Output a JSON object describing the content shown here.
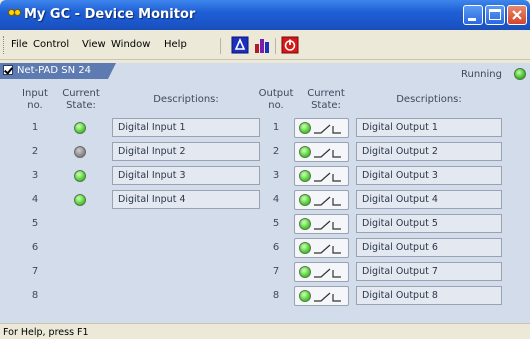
{
  "window": {
    "title": "My GC - Device Monitor"
  },
  "menu": [
    "File",
    "Control",
    "View",
    "Window",
    "Help"
  ],
  "toolbar": {
    "icons": [
      "monitor-icon",
      "bar-chart-icon",
      "power-icon"
    ]
  },
  "device": {
    "tab_label": "Net-PAD SN 24",
    "checked": true,
    "status": "Running",
    "status_color": "#48c630"
  },
  "inputs": {
    "header_no": "Input\nno.",
    "header_state": "Current\nState:",
    "header_desc": "Descriptions:",
    "rows": [
      {
        "no": "1",
        "state": "on",
        "desc": "Digital Input 1"
      },
      {
        "no": "2",
        "state": "off",
        "desc": "Digital Input 2"
      },
      {
        "no": "3",
        "state": "on",
        "desc": "Digital Input 3"
      },
      {
        "no": "4",
        "state": "on",
        "desc": "Digital Input 4"
      },
      {
        "no": "5"
      },
      {
        "no": "6"
      },
      {
        "no": "7"
      },
      {
        "no": "8"
      }
    ]
  },
  "outputs": {
    "header_no": "Output\nno.",
    "header_state": "Current\nState:",
    "header_desc": "Descriptions:",
    "rows": [
      {
        "no": "1",
        "state": "on",
        "desc": "Digital Output 1"
      },
      {
        "no": "2",
        "state": "on",
        "desc": "Digital Output 2"
      },
      {
        "no": "3",
        "state": "on",
        "desc": "Digital Output 3"
      },
      {
        "no": "4",
        "state": "on",
        "desc": "Digital Output 4"
      },
      {
        "no": "5",
        "state": "on",
        "desc": "Digital Output 5"
      },
      {
        "no": "6",
        "state": "on",
        "desc": "Digital Output 6"
      },
      {
        "no": "7",
        "state": "on",
        "desc": "Digital Output 7"
      },
      {
        "no": "8",
        "state": "on",
        "desc": "Digital Output 8"
      }
    ]
  },
  "statusbar": {
    "text": "For Help, press F1"
  }
}
